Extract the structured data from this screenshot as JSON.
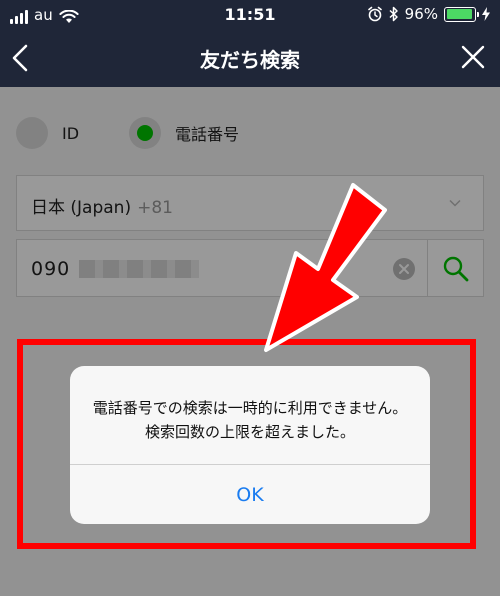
{
  "status": {
    "carrier": "au",
    "time": "11:51",
    "battery_text": "96%",
    "battery_level": 0.96
  },
  "nav": {
    "title": "友だち検索",
    "back_icon": "chevron-left-icon",
    "close_icon": "close-icon"
  },
  "search_type": {
    "options": [
      {
        "label": "ID",
        "selected": false
      },
      {
        "label": "電話番号",
        "selected": true
      }
    ]
  },
  "country": {
    "name": "日本 (Japan)",
    "code": "+81"
  },
  "phone": {
    "value_prefix": "090"
  },
  "alert": {
    "message": "電話番号での検索は一時的に利用できません。検索回数の上限を超えました。",
    "ok_label": "OK"
  },
  "colors": {
    "header_bg": "#1f2638",
    "accent_green": "#00c300",
    "alert_button": "#1a7cf0",
    "annotation_red": "#ff0000"
  }
}
